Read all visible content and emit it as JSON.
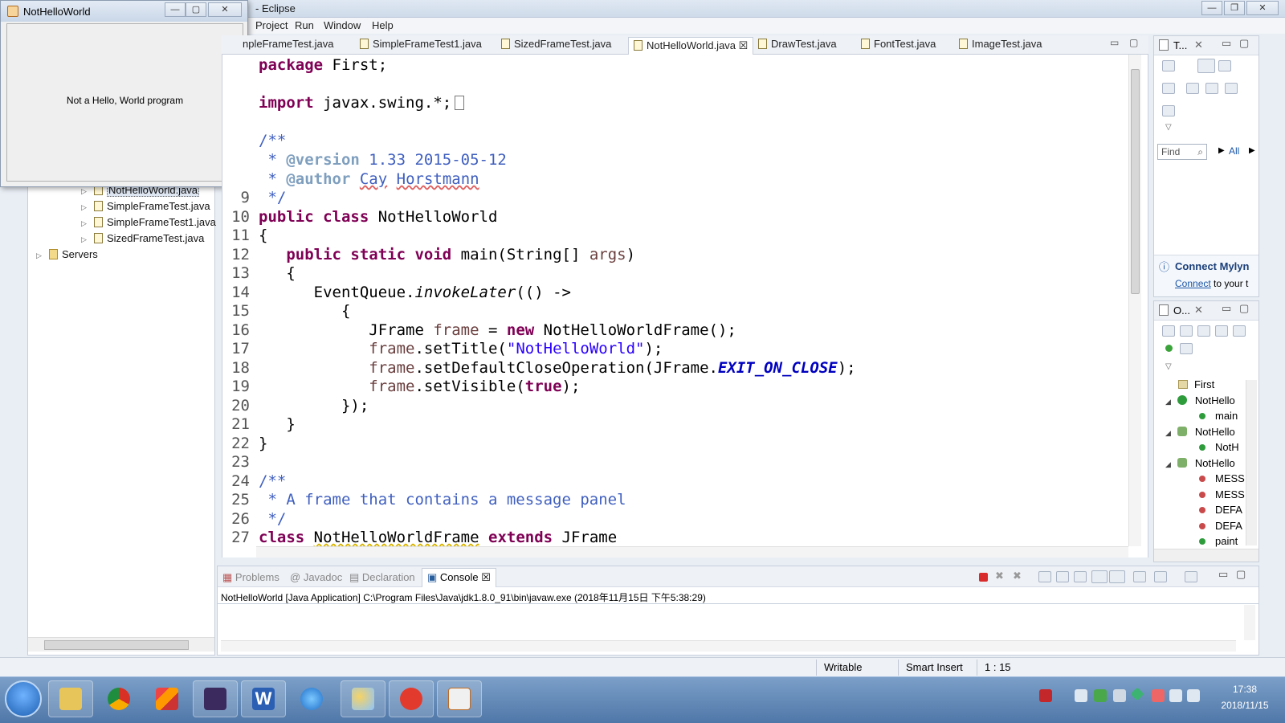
{
  "eclipse": {
    "title": "- Eclipse",
    "menu": [
      "Project",
      "Run",
      "Window",
      "Help"
    ]
  },
  "floating_window": {
    "title": "NotHelloWorld",
    "message": "Not a Hello, World program"
  },
  "package_explorer": {
    "items": [
      {
        "label": "NotHelloWorld.java",
        "selected": true
      },
      {
        "label": "SimpleFrameTest.java"
      },
      {
        "label": "SimpleFrameTest1.java"
      },
      {
        "label": "SizedFrameTest.java"
      },
      {
        "label": "Servers"
      }
    ]
  },
  "editor_tabs": [
    {
      "label": "npleFrameTest.java"
    },
    {
      "label": "SimpleFrameTest1.java"
    },
    {
      "label": "SizedFrameTest.java"
    },
    {
      "label": "NotHelloWorld.java",
      "active": true,
      "close": "☒"
    },
    {
      "label": "DrawTest.java"
    },
    {
      "label": "FontTest.java"
    },
    {
      "label": "ImageTest.java"
    }
  ],
  "editor": {
    "line_numbers": [
      "",
      "",
      "",
      "",
      "",
      "",
      "",
      "9",
      "10",
      "11",
      "12",
      "13",
      "14",
      "15",
      "16",
      "17",
      "18",
      "19",
      "20",
      "21",
      "22",
      "23",
      "24",
      "25",
      "26",
      "27"
    ],
    "code": {
      "l1a": "package",
      "l1b": " First;",
      "l3a": "import",
      "l3b": " javax.swing.*;",
      "l5": "/**",
      "l6a": " * ",
      "l6b": "@version",
      "l6c": " 1.33 2015-05-12",
      "l7a": " * ",
      "l7b": "@author",
      "l7c": " ",
      "l7d": "Cay",
      "l7e": " ",
      "l7f": "Horstmann",
      "l8": " */",
      "l9a": "public class",
      "l9b": " NotHelloWorld",
      "l10": "{",
      "l11a": "   ",
      "l11b": "public static void",
      "l11c": " main(String[] ",
      "l11d": "args",
      "l11e": ")",
      "l12": "   {",
      "l13a": "      EventQueue.",
      "l13b": "invokeLater",
      "l13c": "(() ->",
      "l14": "         {",
      "l15a": "            JFrame ",
      "l15b": "frame",
      "l15c": " = ",
      "l15d": "new",
      "l15e": " NotHelloWorldFrame();",
      "l16a": "            ",
      "l16b": "frame",
      "l16c": ".setTitle(",
      "l16d": "\"NotHelloWorld\"",
      "l16e": ");",
      "l17a": "            ",
      "l17b": "frame",
      "l17c": ".setDefaultCloseOperation(JFrame.",
      "l17d": "EXIT_ON_CLOSE",
      "l17e": ");",
      "l18a": "            ",
      "l18b": "frame",
      "l18c": ".setVisible(",
      "l18d": "true",
      "l18e": ");",
      "l19": "         });",
      "l20": "   }",
      "l21": "}",
      "l23": "/**",
      "l24": " * A frame that contains a message panel",
      "l25": " */",
      "l26a": "class",
      "l26b": " ",
      "l26c": "NotHelloWorldFrame",
      "l26d": " ",
      "l26e": "extends",
      "l26f": " JFrame"
    }
  },
  "task_panel": {
    "title": "T...",
    "find_placeholder": "Find",
    "all_label": "All",
    "connect_title": "Connect Mylyn",
    "connect_link": "Connect",
    "connect_rest": " to your t"
  },
  "outline_panel": {
    "title": "O...",
    "items": [
      "First",
      "NotHello",
      "main",
      "NotHello",
      "NotH",
      "NotHello",
      "MESS",
      "MESS",
      "DEFA",
      "DEFA",
      "paint"
    ]
  },
  "console": {
    "tabs": [
      "Problems",
      "Javadoc",
      "Declaration",
      "Console"
    ],
    "header": "NotHelloWorld [Java Application] C:\\Program Files\\Java\\jdk1.8.0_91\\bin\\javaw.exe (2018年11月15日 下午5:38:29)"
  },
  "status": {
    "writable": "Writable",
    "insert_mode": "Smart Insert",
    "position": "1 : 15"
  },
  "taskbar": {
    "time": "17:38",
    "date": "2018/11/15"
  },
  "colors": {
    "keyword": "#7f0055",
    "comment": "#3f5fbf",
    "string": "#2a00ff",
    "field": "#0000c0"
  }
}
